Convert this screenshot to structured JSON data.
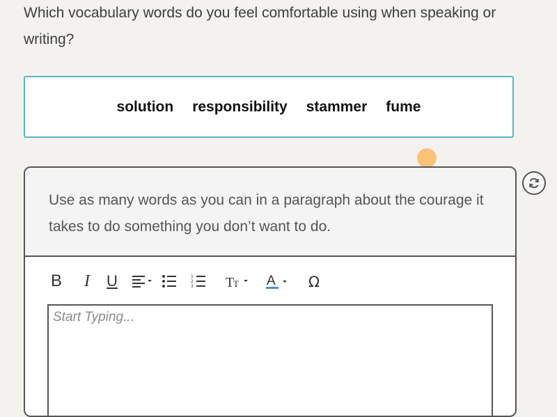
{
  "question": "Which vocabulary words do you feel comfortable using when speaking or writing?",
  "vocabulary": [
    "solution",
    "responsibility",
    "stammer",
    "fume"
  ],
  "prompt": "Use as many words as you can in a paragraph about the courage it takes to do something you don’t want to do.",
  "toolbar": {
    "bold": "B",
    "italic": "I",
    "underline": "U",
    "icons": [
      "bold-icon",
      "italic-icon",
      "underline-icon",
      "align-icon",
      "bullet-list-icon",
      "numbered-list-icon",
      "text-size-icon",
      "font-color-icon",
      "special-character-icon"
    ]
  },
  "editor": {
    "placeholder": "Start Typing..."
  },
  "colors": {
    "accent_border": "#5bb5c0",
    "dot": "#fcc27a",
    "font_color_underline": "#4a90c8"
  }
}
